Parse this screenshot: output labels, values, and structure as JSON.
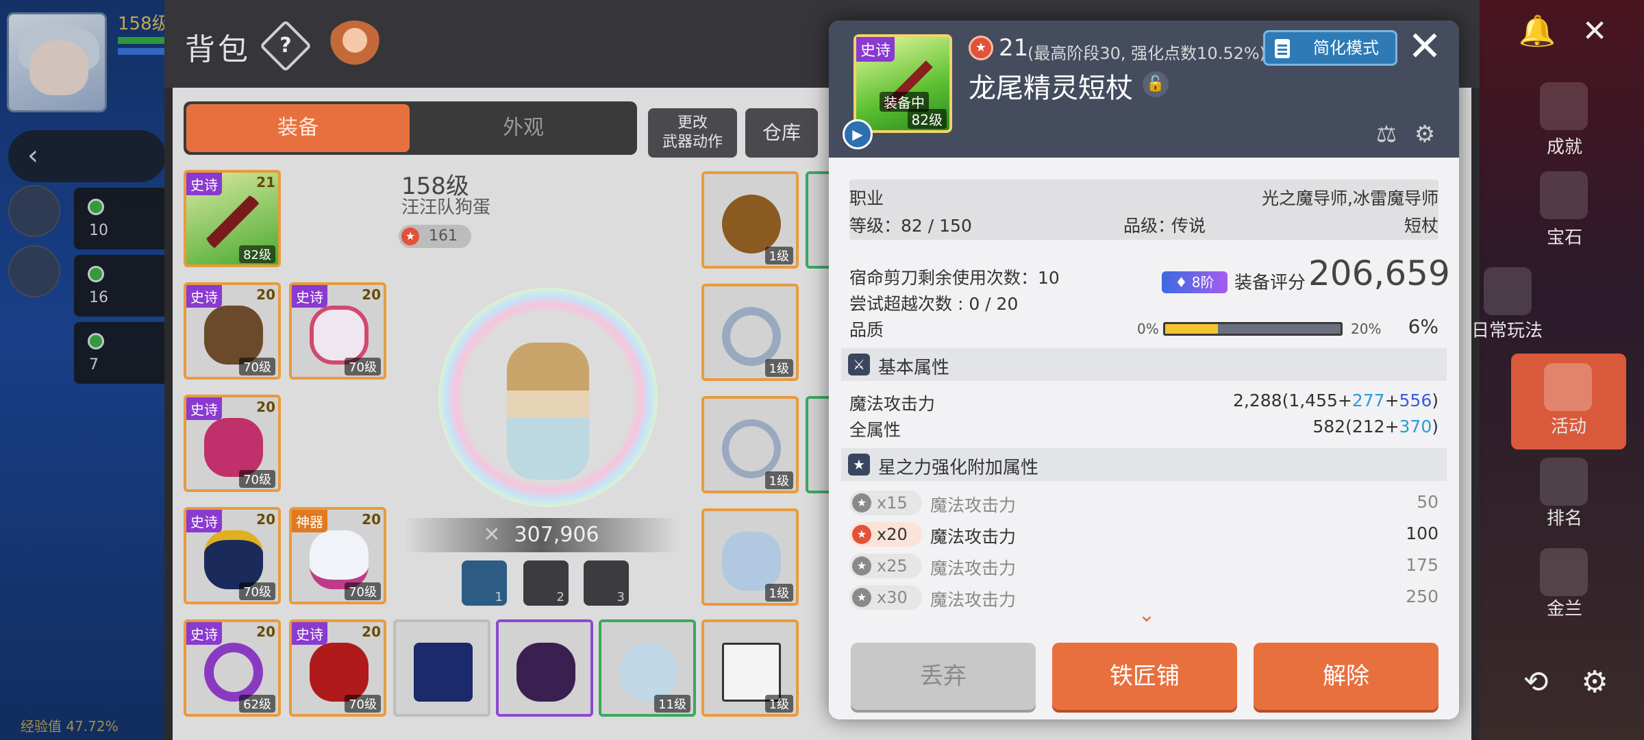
{
  "hud": {
    "player_level": "158级",
    "exp": "经验值 47.72%"
  },
  "inventory": {
    "title": "背包",
    "tabs": [
      "装备",
      "外观"
    ],
    "buttons": {
      "change_weapon": "更改\n武器动作",
      "warehouse": "仓库"
    },
    "character": {
      "level": "158级",
      "name": "汪汪队狗蛋",
      "star_force": "161",
      "combat_power": "307,906"
    },
    "presets": [
      "1",
      "2",
      "3"
    ],
    "slots": [
      {
        "tag": "史诗",
        "stars": "21",
        "level": "82级"
      },
      {
        "tag": "史诗",
        "stars": "20",
        "level": "70级"
      },
      {
        "tag": "史诗",
        "stars": "20",
        "level": "70级"
      },
      {
        "tag": "史诗",
        "stars": "20",
        "level": "70级"
      },
      {
        "tag": "史诗",
        "stars": "20",
        "level": "70级"
      },
      {
        "tag": "神器",
        "stars": "20",
        "level": "70级"
      },
      {
        "tag": "史诗",
        "stars": "20",
        "level": "62级"
      },
      {
        "tag": "史诗",
        "stars": "20",
        "level": "70级"
      },
      {
        "tag": "",
        "stars": "",
        "level": "11级"
      }
    ],
    "right_slot_levels": [
      "1级",
      "1级",
      "1级",
      "1级",
      "1级"
    ]
  },
  "item": {
    "grade_tag": "史诗",
    "equipped_label": "装备中",
    "level_badge": "82级",
    "star_count": "21",
    "star_note": "(最高阶段30, 强化点数10.52%)",
    "simple_mode": "简化模式",
    "name": "龙尾精灵短杖",
    "job_label": "职业",
    "job_value": "光之魔导师,冰雷魔导师",
    "level_label": "等级：82 / 150",
    "grade_label": "品级：",
    "grade_value": "传说",
    "type_value": "短杖",
    "scissors": "宿命剪刀剩余使用次数：10",
    "transcend": "尝试超越次数 : 0 / 20",
    "quality_label": "品质",
    "quality_min": "0%",
    "quality_max": "20%",
    "quality_value": "6%",
    "quality_fraction": 0.3,
    "tier": "8阶",
    "score_label": "装备评分",
    "score": "206,659",
    "basic_header": "基本属性",
    "basic_stats": [
      {
        "name": "魔法攻击力",
        "base": "2,288(1,455+",
        "plus1": "277",
        "sep": "+",
        "plus2": "556",
        "end": ")"
      },
      {
        "name": "全属性",
        "base": "582(212+",
        "plus1": "370",
        "sep": "",
        "plus2": "",
        "end": ")"
      }
    ],
    "starforce_header": "星之力强化附加属性",
    "starforce_rows": [
      {
        "mult": "x15",
        "name": "魔法攻击力",
        "value": "50"
      },
      {
        "mult": "x20",
        "name": "魔法攻击力",
        "value": "100"
      },
      {
        "mult": "x25",
        "name": "魔法攻击力",
        "value": "175"
      },
      {
        "mult": "x30",
        "name": "魔法攻击力",
        "value": "250"
      }
    ],
    "actions": [
      "丢弃",
      "铁匠铺",
      "解除"
    ]
  },
  "right_menu": [
    "成就",
    "宝石",
    "日常玩法",
    "活动",
    "排名",
    "金兰"
  ],
  "colors": {
    "accent": "#e8703e",
    "epic": "#8a3ad0",
    "blue_stat": "#2b9bd8",
    "purple_stat": "#3a5bd8"
  }
}
